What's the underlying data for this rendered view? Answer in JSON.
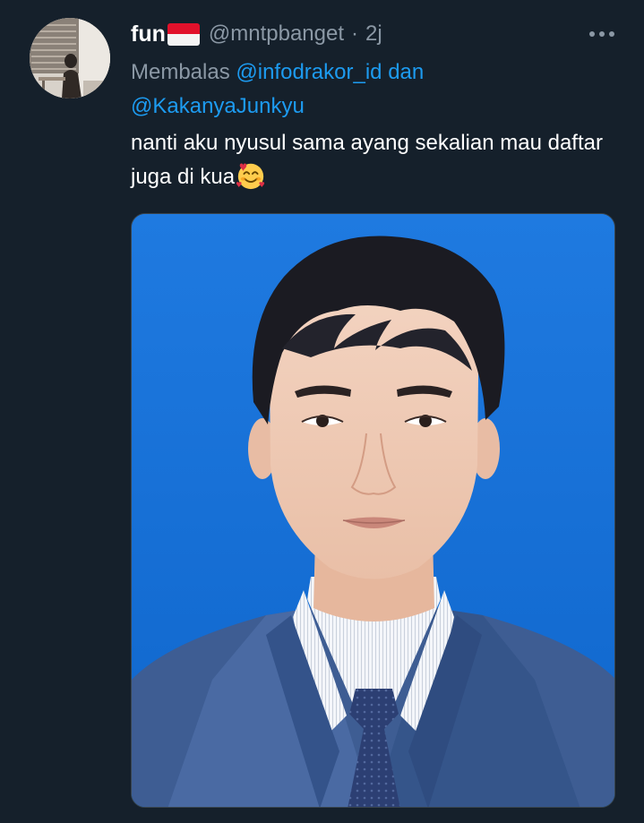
{
  "tweet": {
    "display_name": "fun",
    "handle": "@mntpbanget",
    "separator": "·",
    "time": "2j",
    "reply_prefix": "Membalas",
    "mention_1": "@infodrakor_id",
    "mention_joiner": "dan",
    "mention_2": "@KakanyaJunkyu",
    "text": "nanti aku nyusul sama ayang sekalian mau daftar juga di kua"
  },
  "icons": {
    "flag": "indonesia-flag-icon",
    "more": "more-options-icon",
    "emoji": "smiling-face-with-hearts-icon"
  },
  "colors": {
    "background": "#15202b",
    "secondary_text": "#8b98a5",
    "link": "#1d9bf0",
    "photo_background": "#1470d6"
  }
}
